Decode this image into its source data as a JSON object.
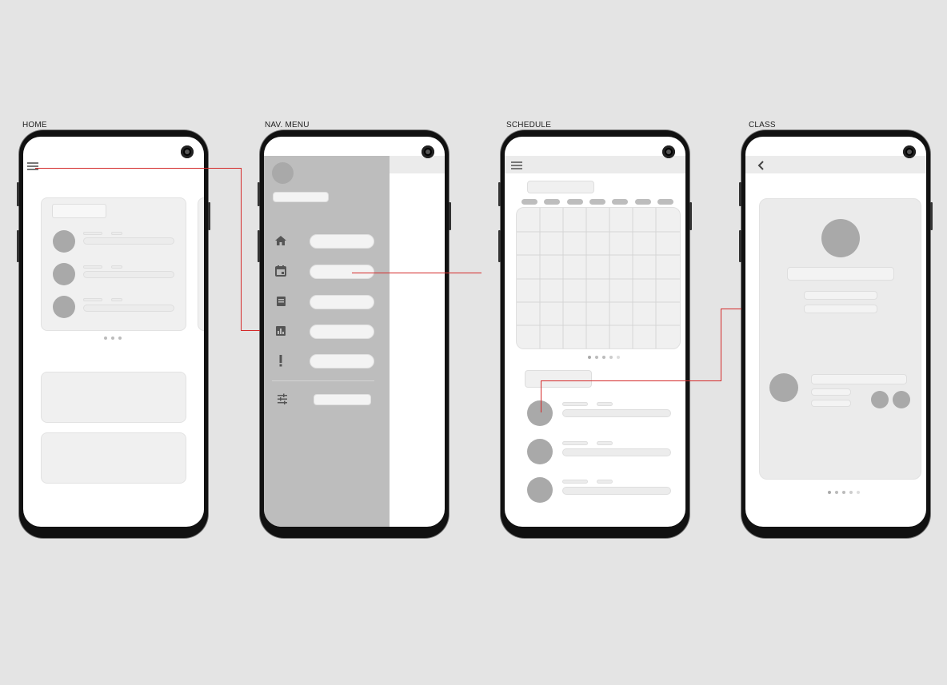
{
  "screens": {
    "home": {
      "label": "HOME"
    },
    "nav_menu": {
      "label": "NAV. MENU"
    },
    "schedule": {
      "label": "SCHEDULE"
    },
    "class": {
      "label": "CLASS"
    }
  },
  "icons": {
    "menu": "hamburger-menu-icon",
    "back": "chevron-left-icon",
    "home": "home-icon",
    "calendar": "calendar-icon",
    "book": "book-icon",
    "chart": "bar-chart-icon",
    "alert": "exclamation-icon",
    "settings": "sliders-icon"
  },
  "colors": {
    "background": "#e4e4e4",
    "flow_line": "#d42a2a",
    "drawer": "#bdbdbd",
    "avatar": "#a9a9a9"
  },
  "carousel": {
    "home_pages": 3,
    "schedule_pages": 5,
    "class_pages": 5
  }
}
